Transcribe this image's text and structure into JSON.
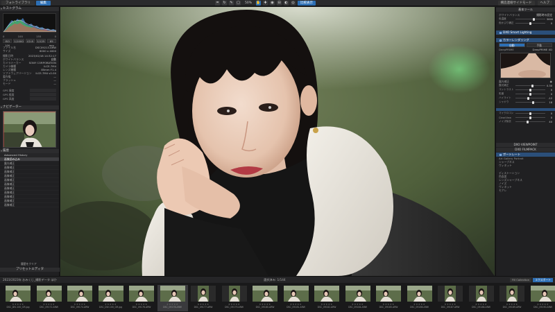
{
  "topbar": {
    "tabs": [
      "フォトライブラリ",
      "編集"
    ],
    "zoom": "50%",
    "compare_label": "比較表示",
    "right_buttons": [
      "構造連絡サイドモード",
      "ヘルプ"
    ]
  },
  "left": {
    "histogram_title": "ヒストグラム",
    "histo_values": [
      "0",
      "100",
      "155",
      "0"
    ],
    "exposure_buttons": [
      "ISO 100",
      "1/1000",
      "f/2.8",
      "1/125",
      "85 mm"
    ],
    "meta_rows": [
      {
        "k": "ファイル名",
        "v": "DSC09213.ARW"
      },
      {
        "k": "サイズ",
        "v": "6000 x 4000"
      },
      {
        "k": "撮影日時",
        "v": "2023/02/18 14:32:17"
      },
      {
        "k": "ホワイトバランス",
        "v": "自動"
      },
      {
        "k": "カメラメーカー",
        "v": "SONY CORPORATION"
      },
      {
        "k": "カメラ機種",
        "v": "ILCE-7M4"
      },
      {
        "k": "レンズ機種",
        "v": "85mm F1.4"
      },
      {
        "k": "ソフトウェアバージョン",
        "v": "ILCE-7M4 v2.00"
      },
      {
        "k": "著作権",
        "v": "—"
      },
      {
        "k": "フラッシュ",
        "v": "—"
      },
      {
        "k": "モード",
        "v": "—"
      }
    ],
    "gps_fields": [
      "GPS 緯度",
      "GPS 経度",
      "GPS 高度"
    ],
    "navigator_title": "ナビゲーター",
    "history_title": "履歴",
    "history_header": "Advanced History",
    "history_items": [
      "画像読み込み",
      "露光補正",
      "画像補正",
      "画像補正",
      "画像補正",
      "画像補正",
      "画像補正",
      "画像補正",
      "画像補正",
      "画像補正",
      "画像補正",
      "画像補正",
      "画像補正"
    ],
    "history_button": "履歴をクリア",
    "footer": "プリセットエディタ"
  },
  "right": {
    "basic_title": "基本ツール",
    "wb_label": "ホワイトバランス",
    "wb_value": "撮影時の設定",
    "sliders_top": [
      {
        "label": "色温度",
        "value": "5600",
        "pos": 0.62
      },
      {
        "label": "色かぶり補正",
        "value": "0",
        "pos": 0.5
      }
    ],
    "section_lighting": "DXO Smart Lighting",
    "section_color": "カラーレンダリング",
    "auto_labels": [
      "自動",
      "手動"
    ],
    "deepprime": [
      "DeepPRIME",
      "DeepPRIME XD"
    ],
    "light_title": "露光補正",
    "sliders_mid": [
      {
        "label": "露光補正",
        "value": "0.30",
        "pos": 0.56
      },
      {
        "label": "コントラスト",
        "value": "0",
        "pos": 0.5
      },
      {
        "label": "彩度",
        "value": "0",
        "pos": 0.5
      },
      {
        "label": "ハイライト",
        "value": "-12",
        "pos": 0.44
      },
      {
        "label": "シャドウ",
        "value": "18",
        "pos": 0.6
      }
    ],
    "sliders_low": [
      {
        "label": "マイクロコントラスト",
        "value": "0",
        "pos": 0.5
      },
      {
        "label": "ClearView",
        "value": "0",
        "pos": 0.5
      },
      {
        "label": "ノイズ除去",
        "value": "40",
        "pos": 0.4
      }
    ],
    "viewpoint": "DXO VIEWPOINT",
    "filmpack": "DXO FILMPACK",
    "filmpack_items": [
      "ポートレート",
      "Art Gallery Portrait",
      "シャープネス",
      "ヴィネット"
    ],
    "bottom_items": [
      "ディストーション",
      "色収差",
      "レンズシャープネス",
      "ノイズ",
      "ヴィネット",
      "モアレ"
    ]
  },
  "film": {
    "path": "2023/2023年 おみくじ_撮影データ ほか",
    "count": "選択済み: 1/144",
    "collection": "Fill Collection",
    "export": "エクスポート",
    "thumbs": [
      {
        "name": "DSC_DIV-100_GR.jpg"
      },
      {
        "name": "DSC_09172.ARW"
      },
      {
        "name": "DSC_09174.ARW"
      },
      {
        "name": "DSC_DIV-100_GR.jpg"
      },
      {
        "name": "DSC_09176.ARW"
      },
      {
        "name": "DSC_09178.ARW"
      },
      {
        "name": "DSC_09177.ARW"
      },
      {
        "name": "DSC_09179.ARW"
      },
      {
        "name": "DSC_09180.ARW"
      },
      {
        "name": "DSC_09181.ARW"
      },
      {
        "name": "DSC_09182.ARW"
      },
      {
        "name": "DSC_09184.ARW"
      },
      {
        "name": "DSC_09185.ARW"
      },
      {
        "name": "DSC_09186.ARW"
      },
      {
        "name": "DSC_09187.ARW"
      },
      {
        "name": "DSC_09188.ARW"
      },
      {
        "name": "DSC_09189.ARW"
      },
      {
        "name": "DSC_09190.ARW"
      }
    ]
  }
}
